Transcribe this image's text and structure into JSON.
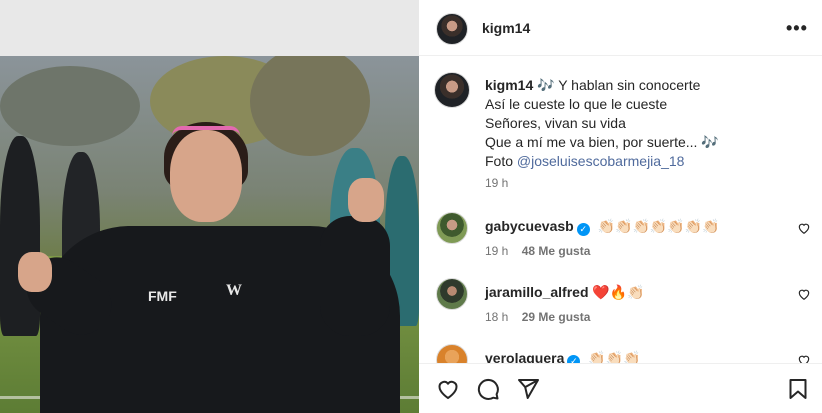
{
  "post": {
    "username": "kigm14",
    "more_label": "•••"
  },
  "caption": {
    "username": "kigm14",
    "lines": [
      "🎶 Y hablan sin conocerte",
      "Así le cueste lo que le cueste",
      "Señores, vivan su vida",
      "Que a mí me va bien, por suerte... 🎶",
      "Foto "
    ],
    "mention": "@joseluisescobarmejia_18",
    "time": "19 h"
  },
  "comments": [
    {
      "username": "gabycuevasb",
      "verified": true,
      "text": "👏🏻👏🏻👏🏻👏🏻👏🏻👏🏻👏🏻",
      "time": "19 h",
      "likes": "48 Me gusta",
      "avatar_color": "#4d6a3a"
    },
    {
      "username": "jaramillo_alfred",
      "verified": false,
      "text": "❤️🔥👏🏻",
      "time": "18 h",
      "likes": "29 Me gusta",
      "avatar_color": "#2f3a2c"
    },
    {
      "username": "verolaguera",
      "verified": true,
      "text": "👏🏻👏🏻👏🏻",
      "time": "",
      "likes": "",
      "avatar_color": "#d9822b"
    }
  ],
  "icons": {
    "like": "heart-icon",
    "comment": "comment-icon",
    "share": "share-icon",
    "save": "bookmark-icon"
  },
  "colors": {
    "mention": "#4f6a9c",
    "verified": "#0095f6",
    "muted": "#737373"
  }
}
